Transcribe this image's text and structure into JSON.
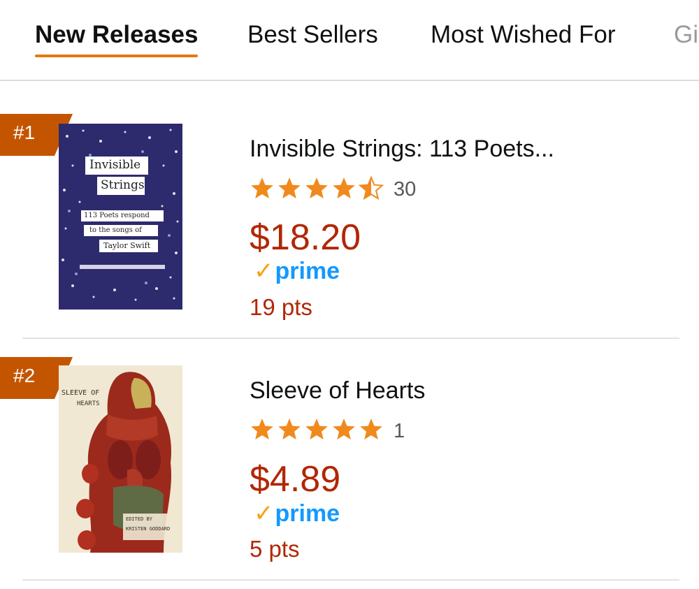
{
  "tabs": [
    {
      "label": "New Releases",
      "active": true
    },
    {
      "label": "Best Sellers",
      "active": false
    },
    {
      "label": "Most Wished For",
      "active": false
    },
    {
      "label": "Gi",
      "active": false
    }
  ],
  "colors": {
    "accent": "#e47911",
    "rank_badge": "#c45500",
    "price": "#b12704",
    "star": "#f08a1d",
    "prime_blue": "#1399ff",
    "prime_check": "#f7a20f"
  },
  "items": [
    {
      "rank": "#1",
      "title": "Invisible Strings: 113 Poets...",
      "rating": 4.5,
      "rating_count": "30",
      "price": "$18.20",
      "prime_label": "prime",
      "points": "19 pts",
      "cover": {
        "title_line1": "Invisible",
        "title_line2": "Strings",
        "sub_line1": "113 Poets respond",
        "sub_line2": "to the songs of",
        "sub_line3": "Taylor Swift"
      }
    },
    {
      "rank": "#2",
      "title": "Sleeve of Hearts",
      "rating": 5,
      "rating_count": "1",
      "price": "$4.89",
      "prime_label": "prime",
      "points": "5 pts",
      "cover": {
        "title_line1": "SLEEVE OF",
        "title_line2": "HEARTS",
        "editor_line1": "EDITED BY",
        "editor_line2": "KRISTEN GODDARD"
      }
    }
  ]
}
